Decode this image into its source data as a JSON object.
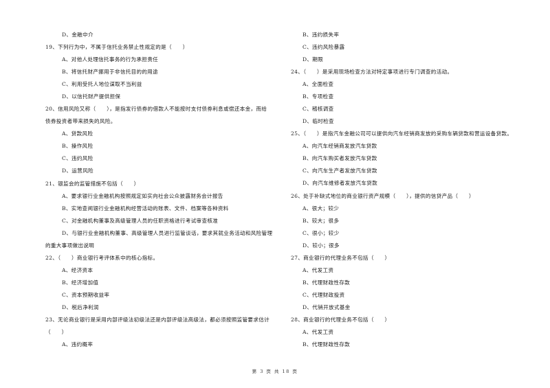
{
  "page": {
    "footer": "第 3 页 共 18 页"
  },
  "left": {
    "q18_tail": {
      "options": [
        "D、金融中介"
      ]
    },
    "q19": {
      "stem": "19、下列行为中，不属于信托业务禁止性规定的是（　　）",
      "options": [
        "A、对他人处理信托事务的行为承担责任",
        "B、将信托财产挪用于非信托目的的用途",
        "C、利用受托人地位谋取不当利益",
        "D、以信托财产提供担保"
      ]
    },
    "q20": {
      "stem_line1": "20、信用风险又称（　　），是指发行债券的借款人不能按时支付债券利息或偿还本金，而给",
      "stem_line2": "债券投资者带来损失的风险。",
      "options": [
        "A、贷款风险",
        "B、操作风险",
        "C、违约风险",
        "D、运营风险"
      ]
    },
    "q21": {
      "stem": "21、银监会的监管措施不包括（　　）",
      "options": [
        "A、要求银行业金融机构按照规定如实向社会公众披露财务会计报告",
        "B、实地查阅银行业金融机构经营活动的账表、文件、档案等各种资料",
        "C、对金融机构董事及高级管理人员的任职资格进行考试审查核准",
        "D、与银行业金融机构董事、高级管理人员进行监管谈话，要求其就业务活动和风险管理"
      ],
      "option_d_line2": "的重大事项做出说明"
    },
    "q22": {
      "stem": "22、（　　）商业银行考评体系中的核心指标。",
      "options": [
        "A、经济资本",
        "B、经济增加值",
        "C、资本预期收益率",
        "D、税后净利润"
      ]
    },
    "q23": {
      "stem_line1": "23、无论商业银行是采用内部评级法初级法还是内部评级法高级法，都必须按照监管要求估计",
      "stem_line2": "（　　）",
      "options": [
        "A、违约概率"
      ]
    }
  },
  "right": {
    "q23_tail": {
      "options": [
        "B、违约损失率",
        "C、违约风险暴露",
        "D、期限"
      ]
    },
    "q24": {
      "stem": "24、（　　）是采用现场检查方法对特定事项进行专门调查的活动。",
      "options": [
        "A、全面检查",
        "B、专项检查",
        "C、稽核调查",
        "D、临时检查"
      ]
    },
    "q25": {
      "stem": "25、（　　）是指汽车金融公司可以提供向汽车经销商发放的采购车辆贷款和营运设备贷款。",
      "options": [
        "A、向汽车经销商发放汽车贷款",
        "B、向汽车购买者发放汽车贷款",
        "C、向汽车生产者发放汽车贷款",
        "D、向汽车维修者发放汽车贷款"
      ]
    },
    "q26": {
      "stem": "26、处于补缺式地位的商业银行资产规模（　　），提供的信贷产品（　　）",
      "options": [
        "A、很大；较少",
        "B、较大；很多",
        "C、很小；较少",
        "D、较小；很多"
      ]
    },
    "q27": {
      "stem": "27、商业银行的代理业务不包括（　　）",
      "options": [
        "A、代发工资",
        "B、代理财政性存款",
        "C、代理财政投资",
        "D、代销开放式基金"
      ]
    },
    "q28": {
      "stem": "28、商业银行的代理业务不包括（　　）",
      "options": [
        "A、代发工资",
        "B、代理财政性存款"
      ]
    }
  }
}
